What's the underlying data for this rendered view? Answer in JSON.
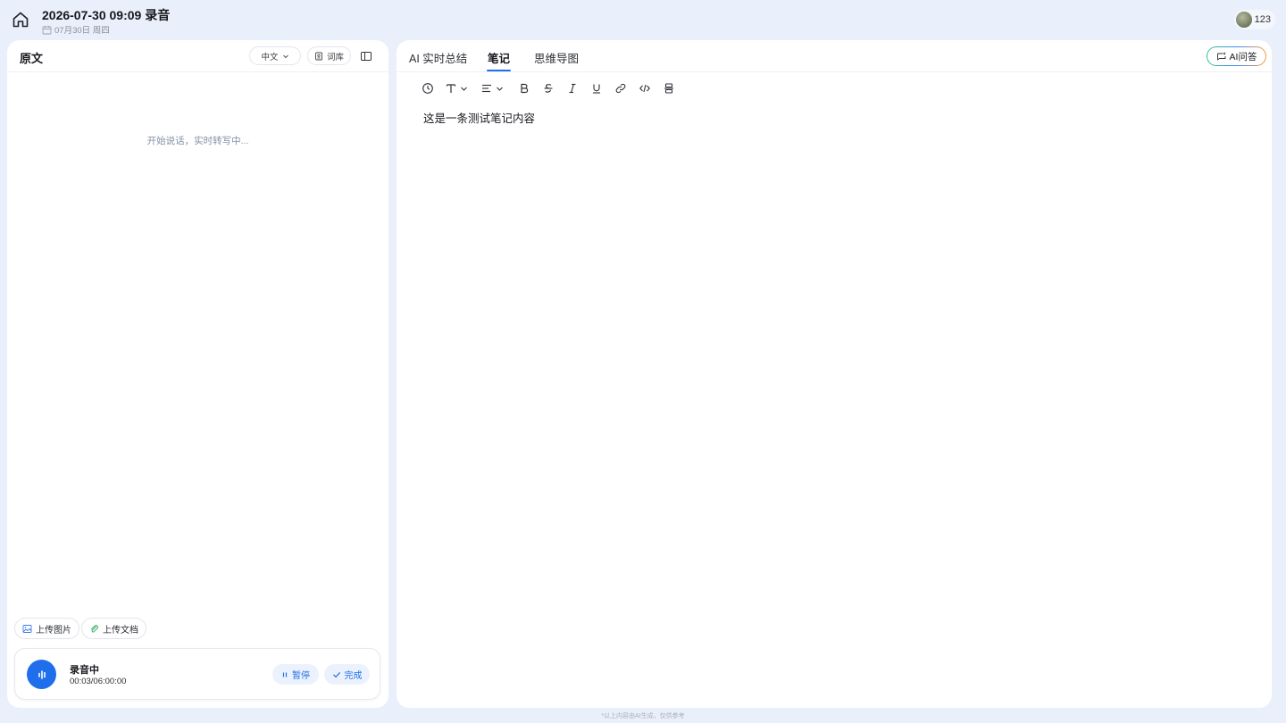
{
  "header": {
    "title": "2026-07-30 09:09 录音",
    "date": "07月30日 周四",
    "user_label": "123"
  },
  "left": {
    "title": "原文",
    "language": "中文",
    "dictionary_label": "词库",
    "placeholder": "开始说话，实时转写中...",
    "upload_image_label": "上传图片",
    "upload_doc_label": "上传文档",
    "recording": {
      "status": "录音中",
      "time": "00:03/06:00:00",
      "pause_label": "暂停",
      "done_label": "完成"
    }
  },
  "right": {
    "tabs": [
      {
        "label": "AI 实时总结"
      },
      {
        "label": "笔记",
        "active": true
      },
      {
        "label": "思维导图"
      }
    ],
    "ai_qa_label": "AI问答",
    "note_content": "这是一条测试笔记内容"
  },
  "footer": {
    "note": "*以上内容由AI生成，仅供参考"
  },
  "colors": {
    "accent": "#1f6fec",
    "page_background": "#eaf0fb"
  }
}
